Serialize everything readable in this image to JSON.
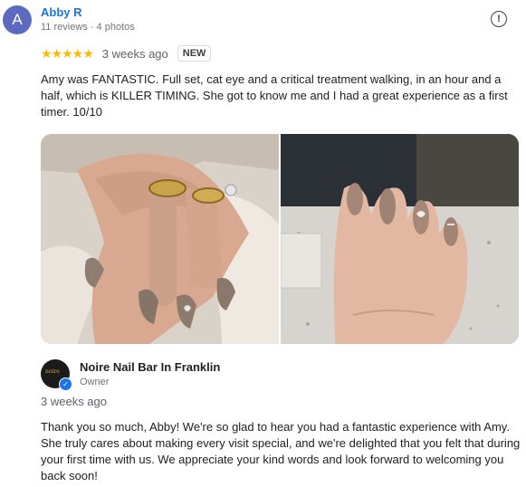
{
  "reviewer": {
    "avatar_letter": "A",
    "name": "Abby R",
    "meta": "11 reviews · 4 photos"
  },
  "review": {
    "stars": "★★★★★",
    "rating": 5,
    "time_ago": "3 weeks ago",
    "badge": "NEW",
    "text": "Amy was FANTASTIC. Full set, cat eye and a critical treatment walking, in an hour and a half, which is KILLER TIMING. She got to know me and I had a great experience as a first timer. 10/10"
  },
  "owner_reply": {
    "business_name": "Noire Nail Bar In Franklin",
    "role": "Owner",
    "time_ago": "3 weeks ago",
    "text": "Thank you so much, Abby! We're so glad to hear you had a fantastic experience with Amy. She truly cares about making every visit special, and we're delighted that you felt that during your first time with us. We appreciate your kind words and look forward to welcoming you back soon!"
  },
  "icons": {
    "info": "info-icon",
    "verified": "verified-check-icon"
  },
  "colors": {
    "reviewer_name": "#1a73e8",
    "avatar_bg": "#5c6bc0",
    "star": "#fbbc04"
  }
}
